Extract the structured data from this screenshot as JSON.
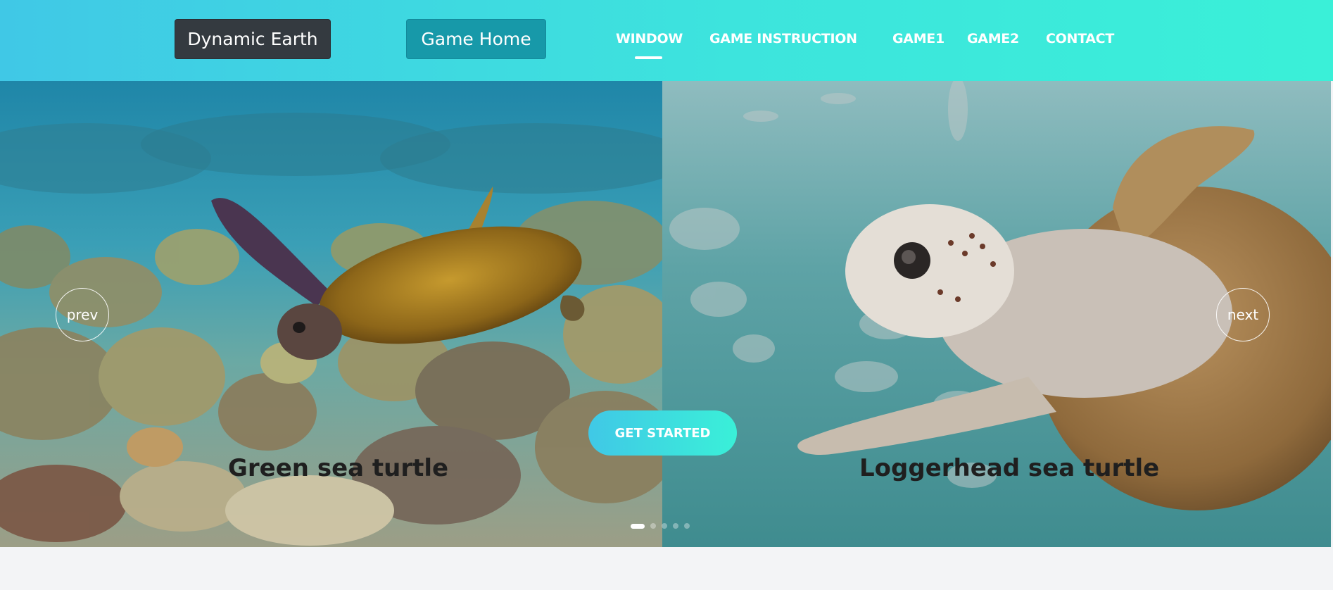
{
  "header": {
    "brand_label": "Dynamic Earth",
    "home_label": "Game Home",
    "nav": [
      {
        "label": "WINDOW",
        "active": true
      },
      {
        "label": "GAME INSTRUCTION",
        "active": false
      },
      {
        "label": "GAME1",
        "active": false
      },
      {
        "label": "GAME2",
        "active": false
      },
      {
        "label": "CONTACT",
        "active": false
      }
    ]
  },
  "carousel": {
    "prev_label": "prev",
    "next_label": "next",
    "cta_label": "GET STARTED",
    "slides": [
      {
        "caption": "Green sea turtle"
      },
      {
        "caption": "Loggerhead sea turtle"
      }
    ],
    "indicator_count": 5,
    "active_indicator": 0
  },
  "colors": {
    "header_gradient_start": "#40c8e6",
    "header_gradient_end": "#3af0d8",
    "brand_button": "#343a40",
    "home_button": "#1799a9"
  }
}
